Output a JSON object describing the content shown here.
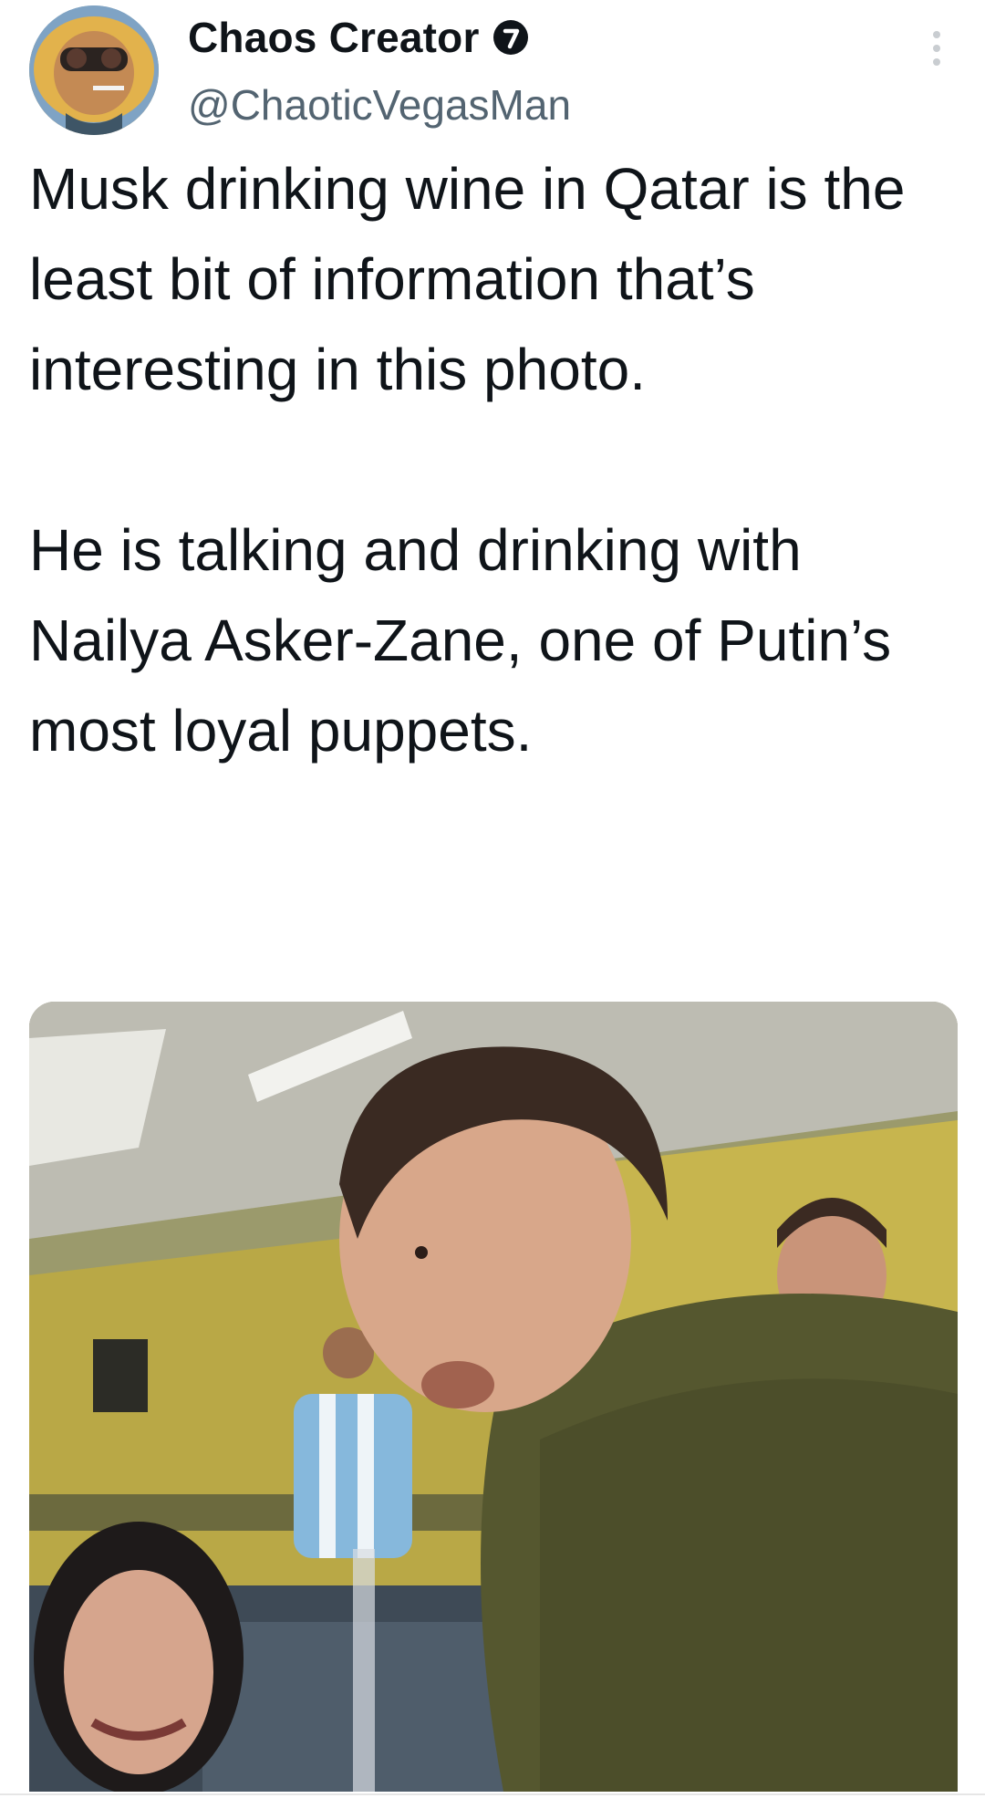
{
  "author": {
    "display_name": "Chaos Creator",
    "handle": "@ChaoticVegasMan",
    "avatar_icon": "avatar-photo",
    "badge_icon": "verified-badge-icon"
  },
  "menu": {
    "more_icon": "more-options-icon"
  },
  "tweet": {
    "paragraphs": [
      "Musk drinking wine in Qatar is the least bit of information that’s interesting in this photo.",
      "He is talking and drinking with Nailya Asker-Zane, one of Putin’s most loyal puppets."
    ]
  },
  "media": {
    "type": "photo"
  },
  "colors": {
    "text": "#0f1419",
    "secondary": "#536471"
  }
}
